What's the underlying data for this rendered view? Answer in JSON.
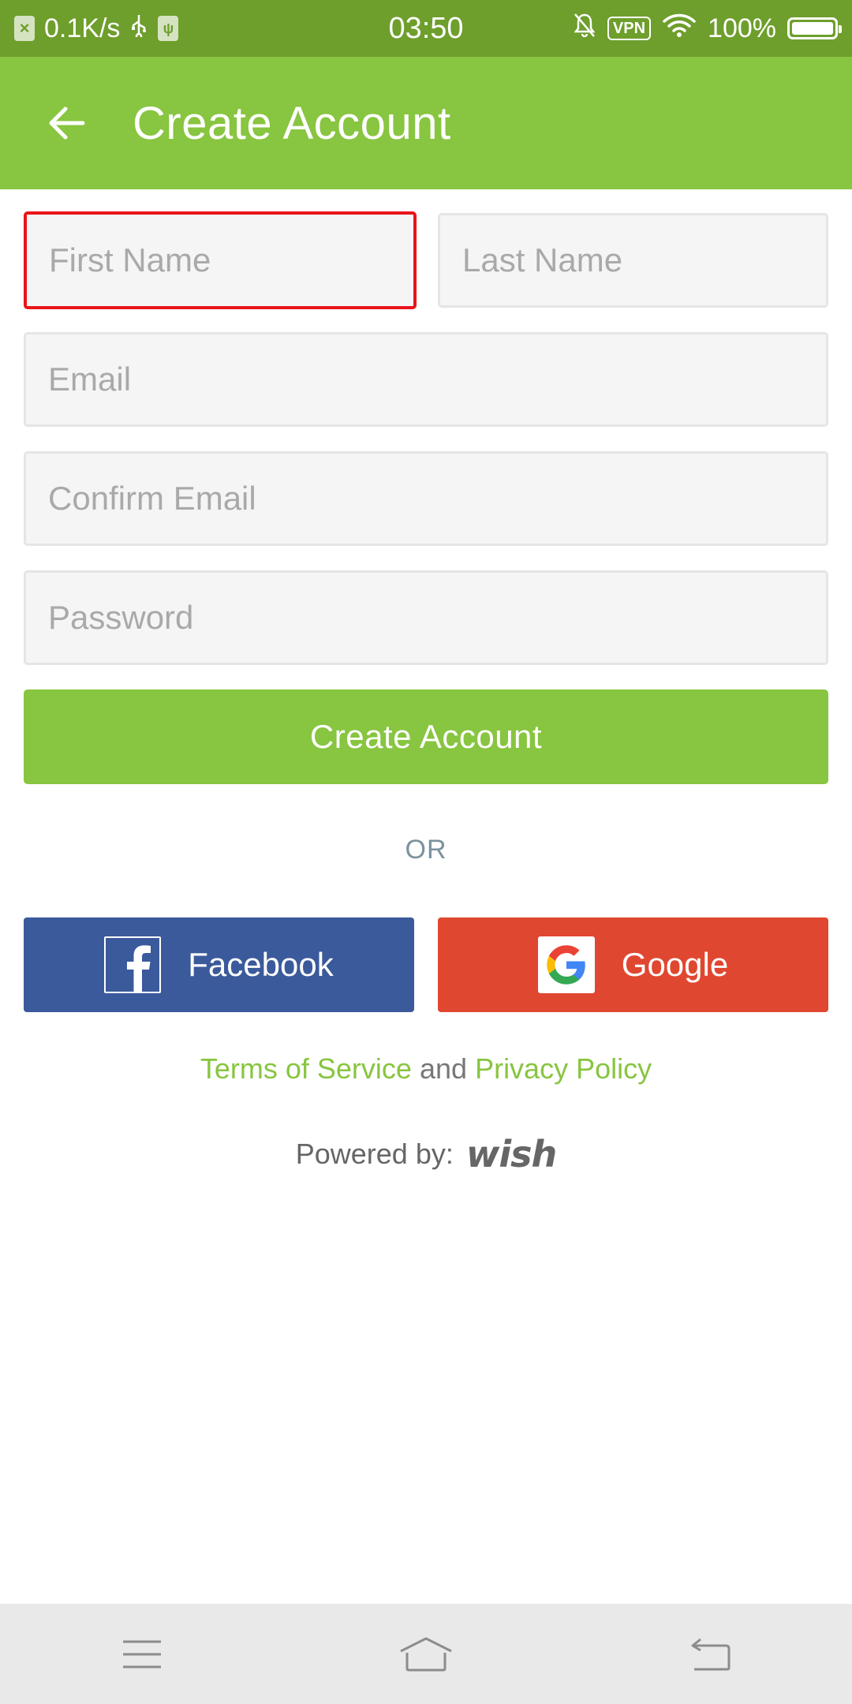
{
  "status_bar": {
    "net_speed": "0.1K/s",
    "time": "03:50",
    "vpn_label": "VPN",
    "battery_text": "100%",
    "battery_level": 1.0
  },
  "app_bar": {
    "title": "Create Account"
  },
  "form": {
    "first_name_placeholder": "First Name",
    "last_name_placeholder": "Last Name",
    "email_placeholder": "Email",
    "confirm_email_placeholder": "Confirm Email",
    "password_placeholder": "Password",
    "submit_label": "Create Account"
  },
  "divider_label": "OR",
  "social": {
    "facebook_label": "Facebook",
    "google_label": "Google"
  },
  "legal": {
    "terms_label": "Terms of Service",
    "joiner": "and",
    "privacy_label": "Privacy Policy"
  },
  "powered": {
    "label": "Powered by:",
    "brand": "wish"
  },
  "colors": {
    "status_bar": "#6e9e2c",
    "accent_green": "#88c540",
    "facebook_blue": "#3b5a9b",
    "google_red": "#e04730",
    "focus_red": "#e8151b",
    "nav_bar": "#e9e9e9"
  },
  "icons": {
    "back": "arrow-left-icon",
    "facebook": "facebook-f-icon",
    "google": "google-g-icon",
    "nav_menu": "menu-icon",
    "nav_home": "home-icon",
    "nav_back": "back-icon"
  }
}
